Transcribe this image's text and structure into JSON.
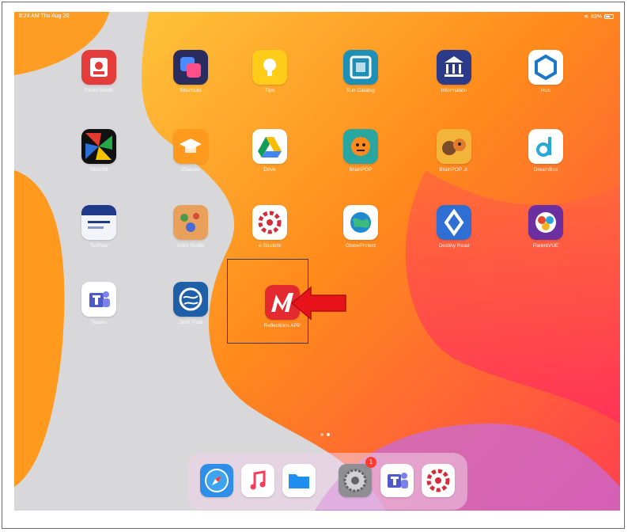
{
  "status_bar": {
    "time": "8:24 AM  Thu Aug 20",
    "battery": "83%"
  },
  "home_apps": [
    {
      "label": "Photo Booth",
      "icon": "photo-booth-icon"
    },
    {
      "label": "Shortcuts",
      "icon": "shortcuts-icon"
    },
    {
      "label": "Tips",
      "icon": "tips-icon"
    },
    {
      "label": "Sun Catalog",
      "icon": "sun-catalog-icon"
    },
    {
      "label": "Information",
      "icon": "information-icon"
    },
    {
      "label": "Hub",
      "icon": "hub-icon"
    },
    {
      "label": "Sketchit",
      "icon": "sketchit-icon"
    },
    {
      "label": "Classes",
      "icon": "classes-icon"
    },
    {
      "label": "Drive",
      "icon": "google-drive-icon"
    },
    {
      "label": "BrainPOP",
      "icon": "brainpop-icon"
    },
    {
      "label": "BrainPOP Jr.",
      "icon": "brainpop-jr-icon"
    },
    {
      "label": "DreamBox",
      "icon": "dreambox-icon"
    },
    {
      "label": "TestNav",
      "icon": "testnav-icon"
    },
    {
      "label": "Artist Studio",
      "icon": "artist-studio-icon"
    },
    {
      "label": "e-Student",
      "icon": "e-student-icon"
    },
    {
      "label": "GlobeProtect",
      "icon": "globeprotect-icon"
    },
    {
      "label": "Destiny Read",
      "icon": "destiny-read-icon"
    },
    {
      "label": "ParentVUE",
      "icon": "parentvue-icon"
    },
    {
      "label": "Teams",
      "icon": "teams-icon"
    },
    {
      "label": "Jamf Trust",
      "icon": "jamf-trust-icon"
    },
    {
      "label": "Reflections APP",
      "icon": "app-icon"
    }
  ],
  "dock_apps": [
    {
      "label": "Safari",
      "icon": "safari-icon"
    },
    {
      "label": "Music",
      "icon": "music-icon"
    },
    {
      "label": "Files",
      "icon": "files-icon"
    },
    {
      "label": "Settings",
      "icon": "settings-icon"
    },
    {
      "label": "Teams",
      "icon": "teams-icon"
    },
    {
      "label": "e-Student",
      "icon": "e-student-icon"
    }
  ],
  "settings_badge": "1",
  "colors": {
    "arrow": "#e8121a",
    "wallpaper_orange": "#ff8a1c",
    "wallpaper_red": "#ff3f4f"
  }
}
